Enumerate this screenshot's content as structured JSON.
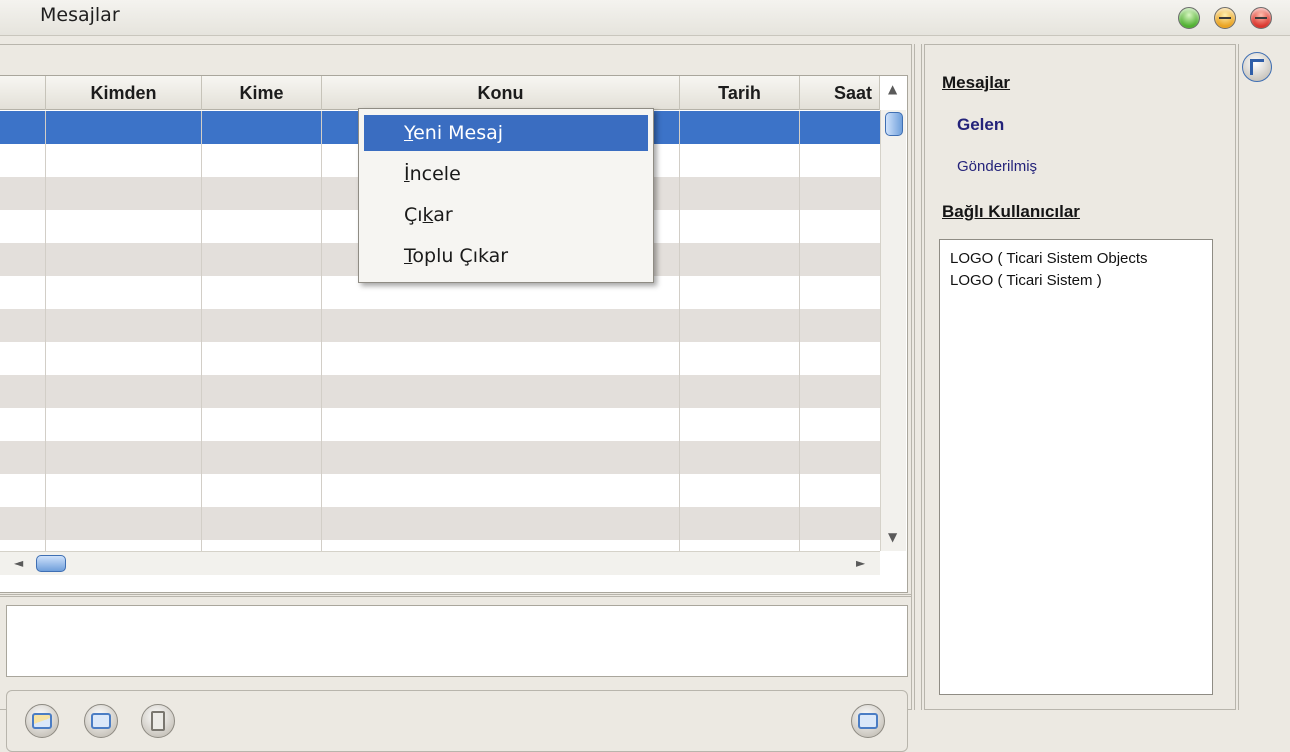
{
  "window": {
    "title": "Mesajlar"
  },
  "grid": {
    "columns": [
      "",
      "Kimden",
      "Kime",
      "Konu",
      "Tarih",
      "Saat"
    ]
  },
  "context_menu": {
    "items": [
      {
        "mnemonic": "Y",
        "rest": "eni Mesaj",
        "prefix": ""
      },
      {
        "mnemonic": "İ",
        "rest": "ncele",
        "prefix": ""
      },
      {
        "prefix": "Çı",
        "mnemonic": "k",
        "rest": "ar"
      },
      {
        "mnemonic": "T",
        "rest": "oplu Çıkar",
        "prefix": ""
      }
    ],
    "active_index": 0
  },
  "side_panel": {
    "messages_title": "Mesajlar",
    "inbox": "Gelen",
    "sent": "Gönderilmiş",
    "users_title": "Bağlı Kullanıcılar",
    "users": [
      "LOGO ( Ticari Sistem Objects",
      "LOGO ( Ticari Sistem )"
    ]
  },
  "toolbar": {
    "buttons": [
      "new-message-icon",
      "inspect-icon",
      "delete-icon"
    ],
    "right_button": "preview-icon"
  },
  "colors": {
    "selection": "#3c73c8",
    "alt_row": "#e3dfdb",
    "link": "#24237a"
  }
}
